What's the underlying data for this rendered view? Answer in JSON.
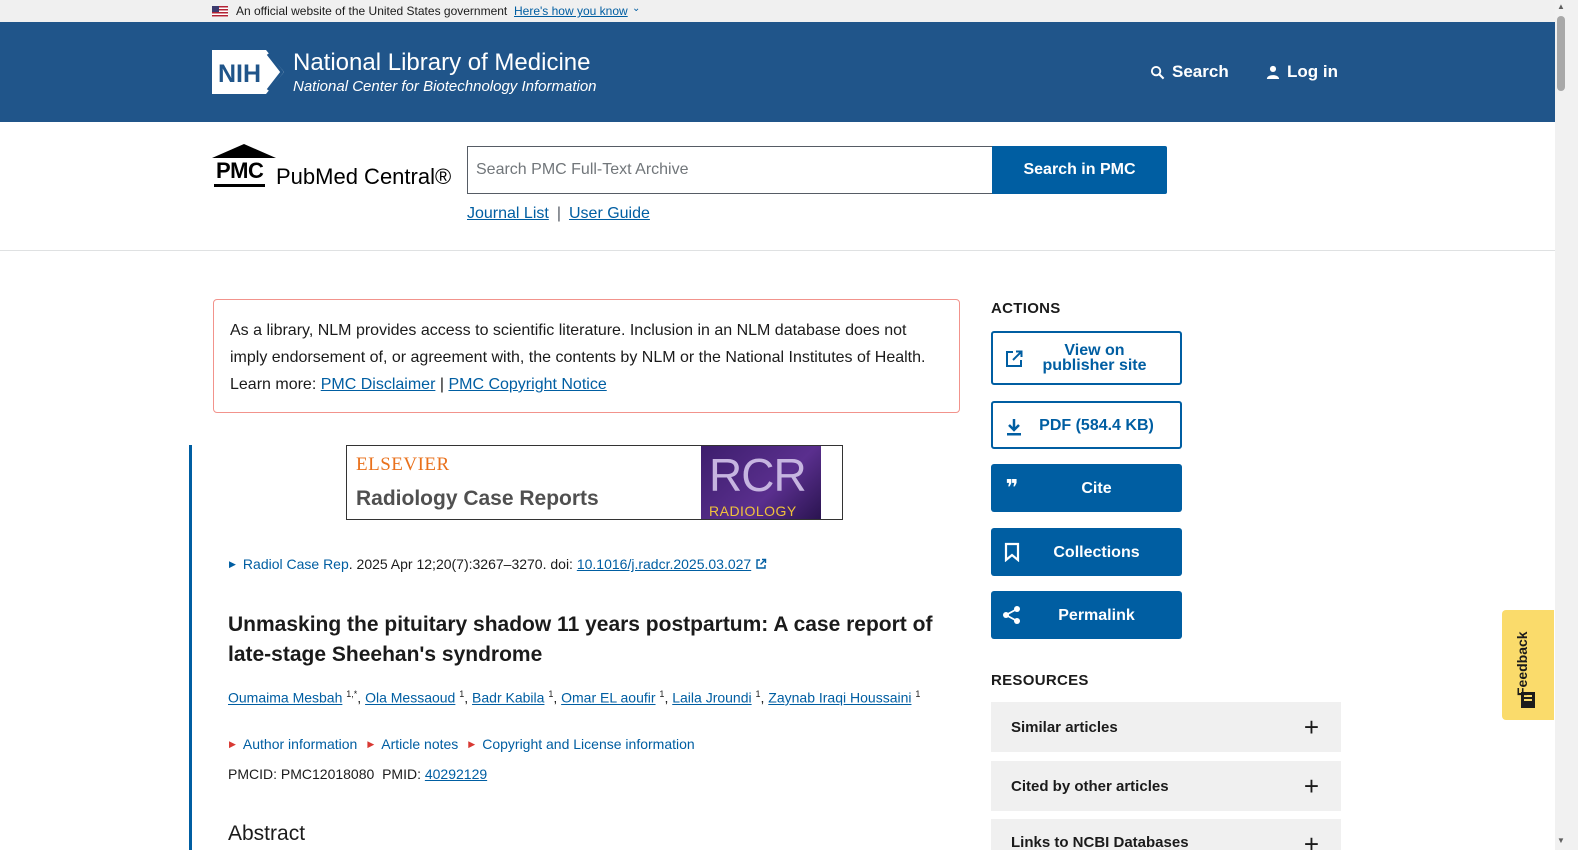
{
  "gov_banner": {
    "text": "An official website of the United States government",
    "how_link": "Here's how you know"
  },
  "nlm_header": {
    "logo_text": "NIH",
    "title": "National Library of Medicine",
    "subtitle": "National Center for Biotechnology Information",
    "search_label": "Search",
    "login_label": "Log in",
    "bg_color": "#20558a"
  },
  "pmc": {
    "logo_abbrev": "PMC",
    "logo_name": "PubMed Central®",
    "search_placeholder": "Search PMC Full-Text Archive",
    "search_button": "Search in PMC",
    "links": [
      "Journal List",
      "User Guide"
    ],
    "link_separator": "|"
  },
  "disclaimer": {
    "text": "As a library, NLM provides access to scientific literature. Inclusion in an NLM database does not imply endorsement of, or agreement with, the contents by NLM or the National Institutes of Health.",
    "learn_more": "Learn more:",
    "link1": "PMC Disclaimer",
    "link_sep": "|",
    "link2": "PMC Copyright Notice"
  },
  "journal_banner": {
    "publisher": "ELSEVIER",
    "journal": "Radiology Case Reports",
    "cover_big": "RCR",
    "cover_small": "RADIOLOGY"
  },
  "article": {
    "journal_abbrev": "Radiol Case Rep",
    "citation": ". 2025 Apr 12;20(7):3267–3270. doi: ",
    "doi": "10.1016/j.radcr.2025.03.027",
    "title": "Unmasking the pituitary shadow 11 years postpartum: A case report of late-stage Sheehan's syndrome",
    "authors": [
      {
        "name": "Oumaima Mesbah",
        "sup": "1,*"
      },
      {
        "name": "Ola Messaoud",
        "sup": "1"
      },
      {
        "name": "Badr Kabila",
        "sup": "1"
      },
      {
        "name": "Omar EL aoufir",
        "sup": "1"
      },
      {
        "name": "Laila Jroundi",
        "sup": "1"
      },
      {
        "name": "Zaynab Iraqi Houssaini",
        "sup": "1"
      }
    ],
    "info_links": [
      "Author information",
      "Article notes",
      "Copyright and License information"
    ],
    "pmcid_label": "PMCID: PMC12018080",
    "pmid_label": "PMID:",
    "pmid": "40292129",
    "abstract_heading": "Abstract"
  },
  "sidebar": {
    "actions_heading": "ACTIONS",
    "actions": [
      {
        "label": "View on publisher site",
        "icon": "external-link-icon",
        "style": "outline"
      },
      {
        "label": "PDF (584.4 KB)",
        "icon": "download-icon",
        "style": "outline"
      },
      {
        "label": "Cite",
        "icon": "quote-icon",
        "style": "solid"
      },
      {
        "label": "Collections",
        "icon": "bookmark-icon",
        "style": "solid"
      },
      {
        "label": "Permalink",
        "icon": "share-icon",
        "style": "solid"
      }
    ],
    "resources_heading": "RESOURCES",
    "resources": [
      "Similar articles",
      "Cited by other articles",
      "Links to NCBI Databases"
    ]
  },
  "feedback_label": "Feedback",
  "colors": {
    "primary_blue": "#005ea2",
    "header_blue": "#20558a",
    "alert_border": "#f2938c",
    "feedback_bg": "#fadb6b"
  }
}
